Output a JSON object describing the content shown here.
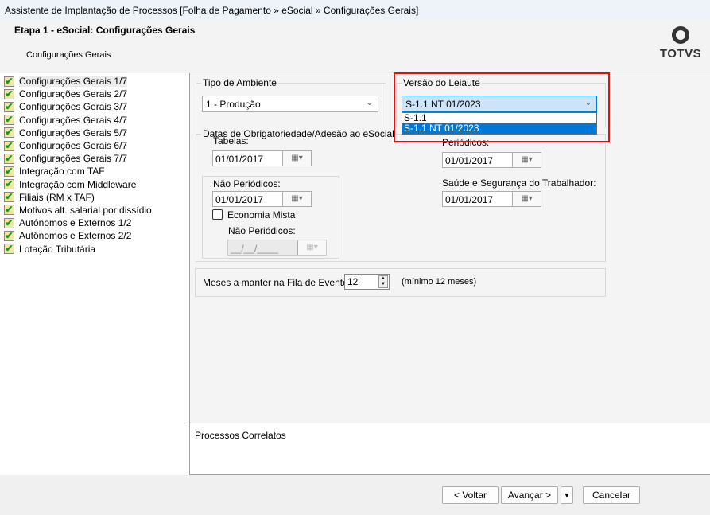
{
  "window": {
    "title": "Assistente de Implantação de Processos [Folha de Pagamento » eSocial » Configurações Gerais]"
  },
  "header": {
    "step_title": "Etapa 1 - eSocial: Configurações Gerais",
    "subtitle": "Configurações Gerais",
    "logo_text": "TOTVS"
  },
  "sidebar": {
    "items": [
      {
        "label": "Configurações Gerais 1/7"
      },
      {
        "label": "Configurações Gerais 2/7"
      },
      {
        "label": "Configurações Gerais 3/7"
      },
      {
        "label": "Configurações Gerais 4/7"
      },
      {
        "label": "Configurações Gerais 5/7"
      },
      {
        "label": "Configurações Gerais 6/7"
      },
      {
        "label": "Configurações Gerais 7/7"
      },
      {
        "label": "Integração com TAF"
      },
      {
        "label": "Integração com Middleware"
      },
      {
        "label": "Filiais (RM x TAF)"
      },
      {
        "label": "Motivos alt. salarial por dissídio"
      },
      {
        "label": "Autônomos e Externos 1/2"
      },
      {
        "label": "Autônomos e Externos 2/2"
      },
      {
        "label": "Lotação Tributária"
      }
    ]
  },
  "tipo_ambiente": {
    "legend": "Tipo de Ambiente",
    "value": "1 - Produção"
  },
  "versao": {
    "legend": "Versão do Leiaute",
    "value": "S-1.1 NT 01/2023",
    "options": [
      "S-1.1",
      "S-1.1 NT 01/2023"
    ]
  },
  "datas": {
    "legend": "Datas de Obrigatoriedade/Adesão ao eSocial",
    "tabelas_label": "Tabelas:",
    "tabelas_value": "01/01/2017",
    "nao_periodicos_label": "Não Periódicos:",
    "nao_periodicos_value": "01/01/2017",
    "economia_mista_label": "Economia Mista",
    "em_nao_periodicos_label": "Não Periódicos:",
    "em_nao_periodicos_value": "__/__/____",
    "periodicos_label": "Periódicos:",
    "periodicos_value": "01/01/2017",
    "sst_label": "Saúde e Segurança do Trabalhador:",
    "sst_value": "01/01/2017"
  },
  "meses": {
    "label": "Meses a manter na Fila de Eventos:",
    "value": "12",
    "hint": "(mínimo 12 meses)"
  },
  "correlatos": {
    "label": "Processos Correlatos"
  },
  "footer": {
    "back": "< Voltar",
    "next": "Avançar >",
    "cancel": "Cancelar"
  }
}
